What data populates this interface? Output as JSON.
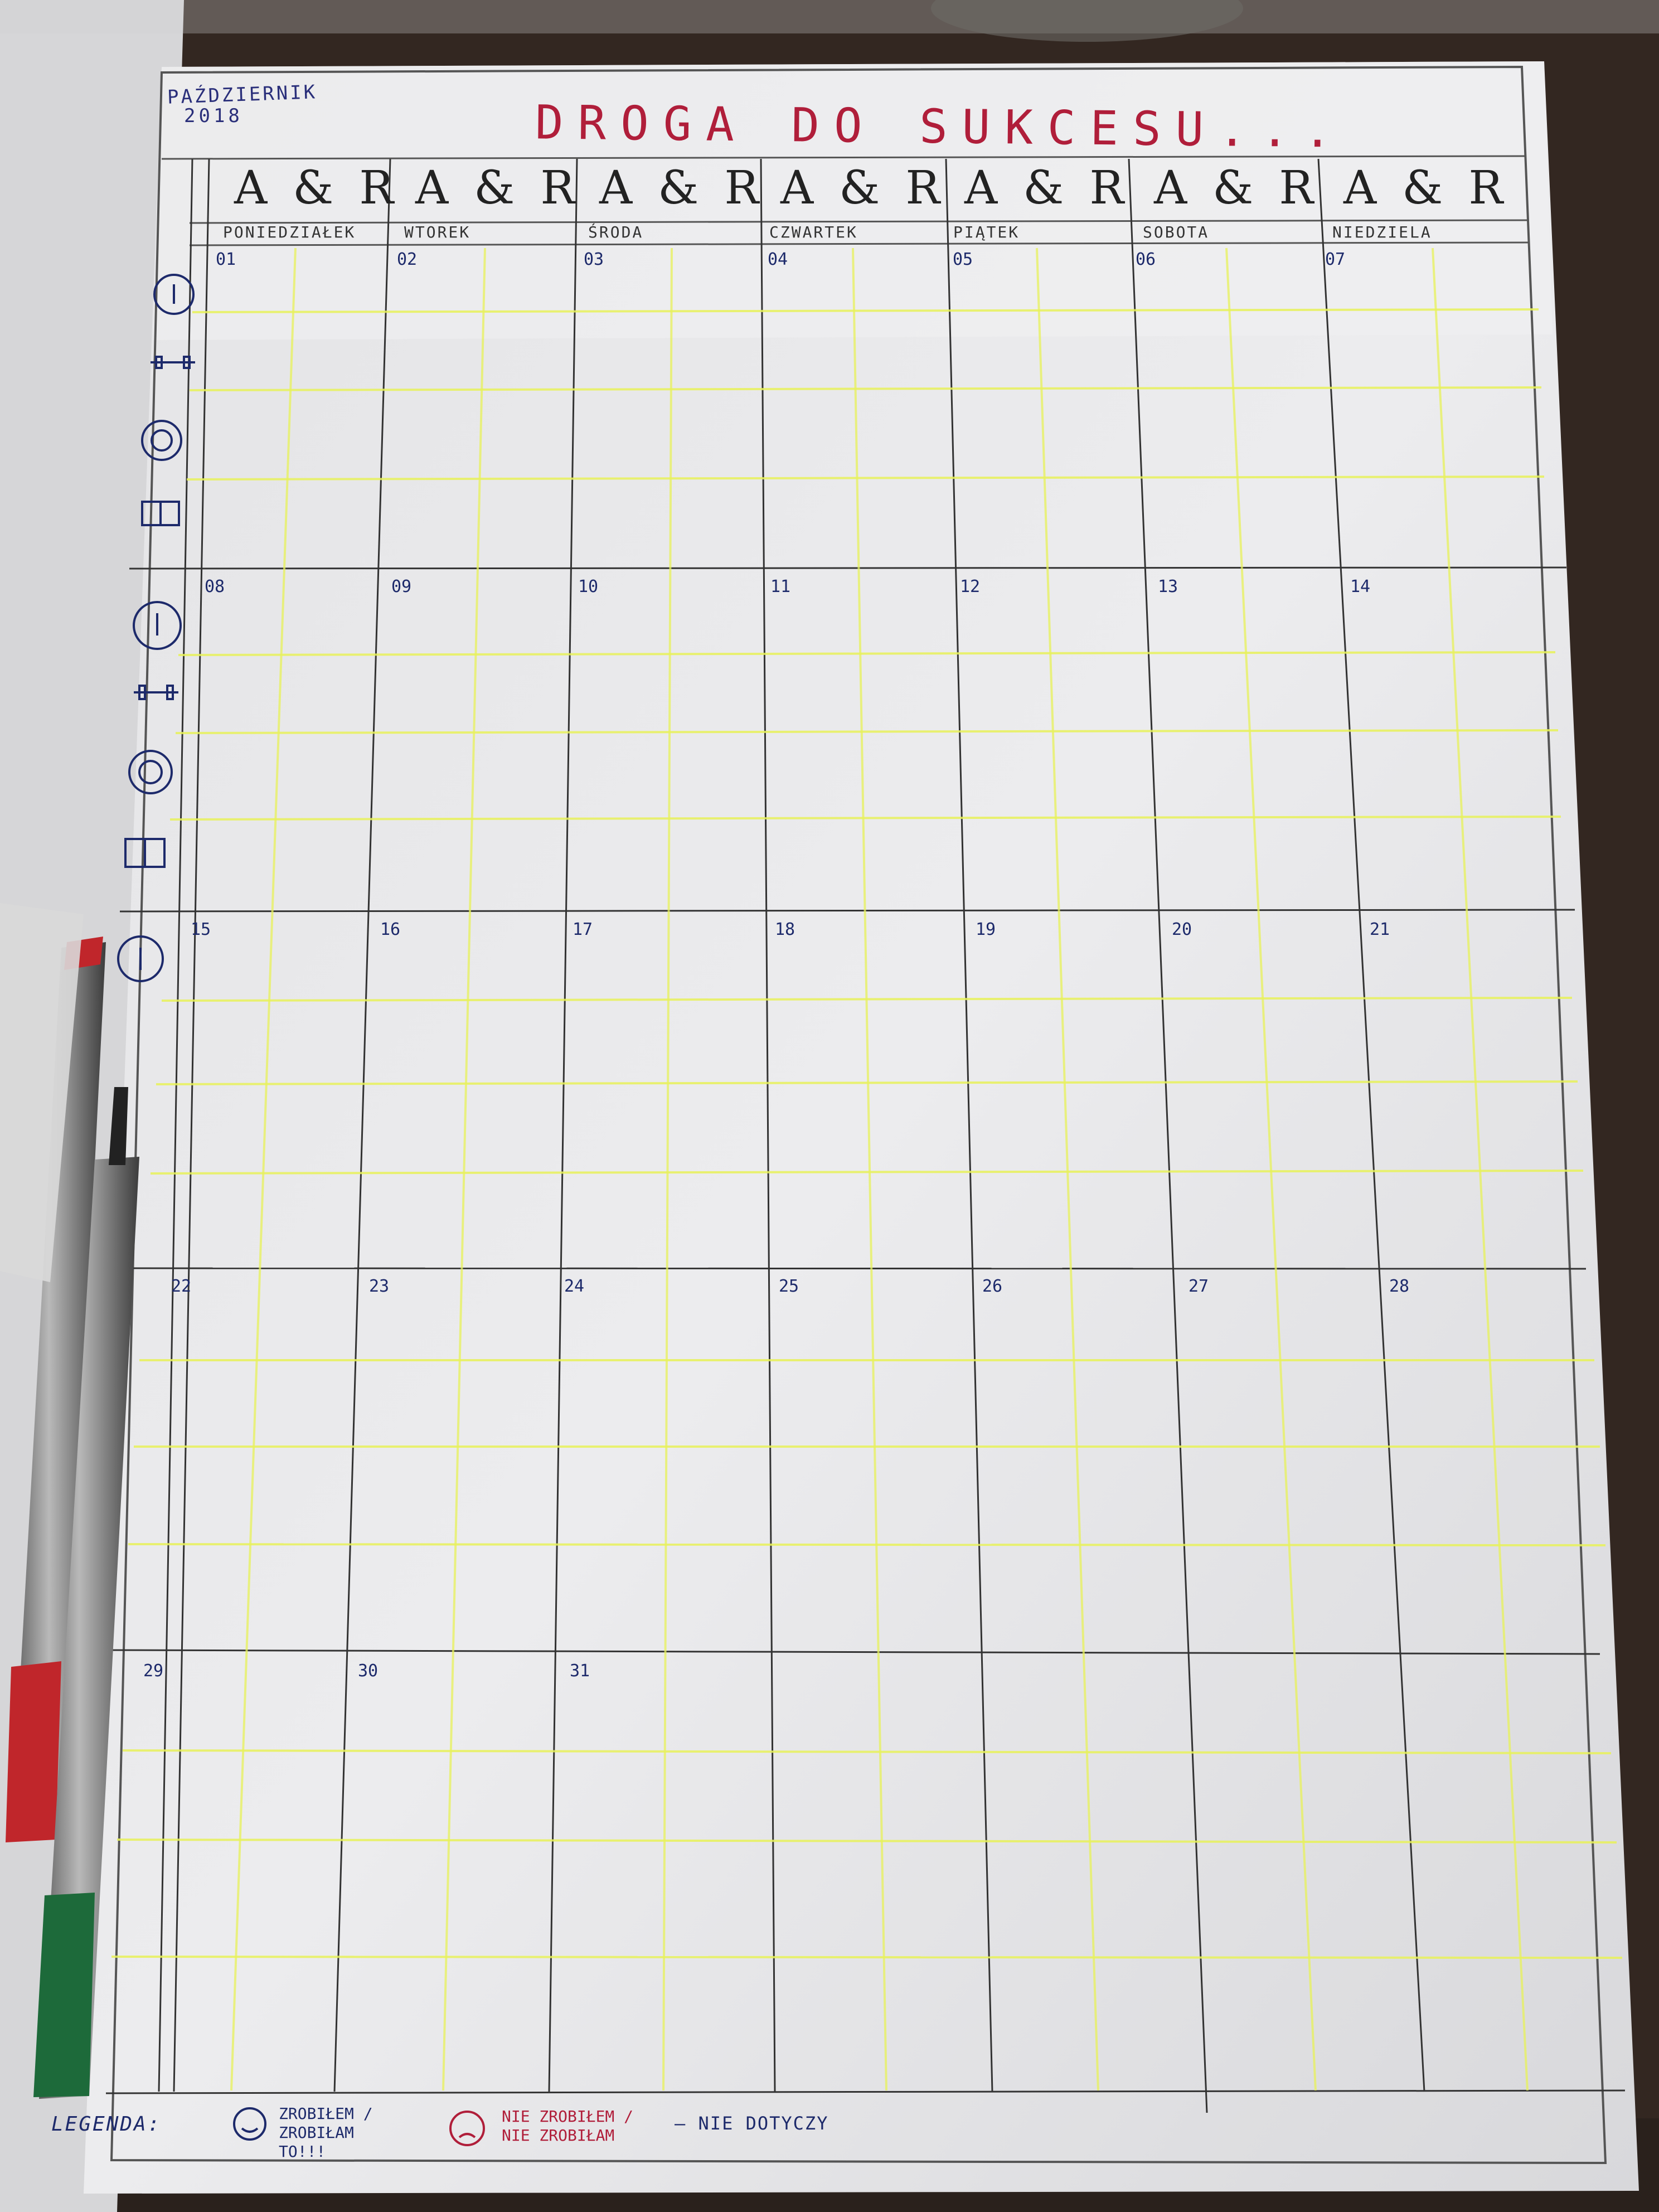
{
  "header": {
    "title": "DROGA DO SUKCESU...",
    "month": "PAŹDZIERNIK",
    "year": "2018"
  },
  "columns": [
    {
      "ar": "A & R",
      "day": "PONIEDZIAŁEK"
    },
    {
      "ar": "A & R",
      "day": "WTOREK"
    },
    {
      "ar": "A & R",
      "day": "ŚRODA"
    },
    {
      "ar": "A & R",
      "day": "CZWARTEK"
    },
    {
      "ar": "A & R",
      "day": "PIĄTEK"
    },
    {
      "ar": "A & R",
      "day": "SOBOTA"
    },
    {
      "ar": "A & R",
      "day": "NIEDZIELA"
    }
  ],
  "weeks": [
    [
      "01",
      "02",
      "03",
      "04",
      "05",
      "06",
      "07"
    ],
    [
      "08",
      "09",
      "10",
      "11",
      "12",
      "13",
      "14"
    ],
    [
      "15",
      "16",
      "17",
      "18",
      "19",
      "20",
      "21"
    ],
    [
      "22",
      "23",
      "24",
      "25",
      "26",
      "27",
      "28"
    ],
    [
      "29",
      "30",
      "31",
      "",
      "",
      "",
      ""
    ]
  ],
  "row_icons": [
    "clock-icon",
    "dumbbell-icon",
    "plate-icon",
    "book-icon"
  ],
  "legend": {
    "label": "LEGENDA:",
    "done": "ZROBIŁEM / ZROBIŁAM TO!!!",
    "not_done": "NIE ZROBIŁEM / NIE ZROBIŁAM",
    "na": "— NIE DOTYCZY"
  },
  "colors": {
    "title": "#b01e3a",
    "ink": "#1d2a6b",
    "highlighter": "#e8f25a",
    "desk": "#2a211c",
    "paper": "#e9e9ea"
  }
}
